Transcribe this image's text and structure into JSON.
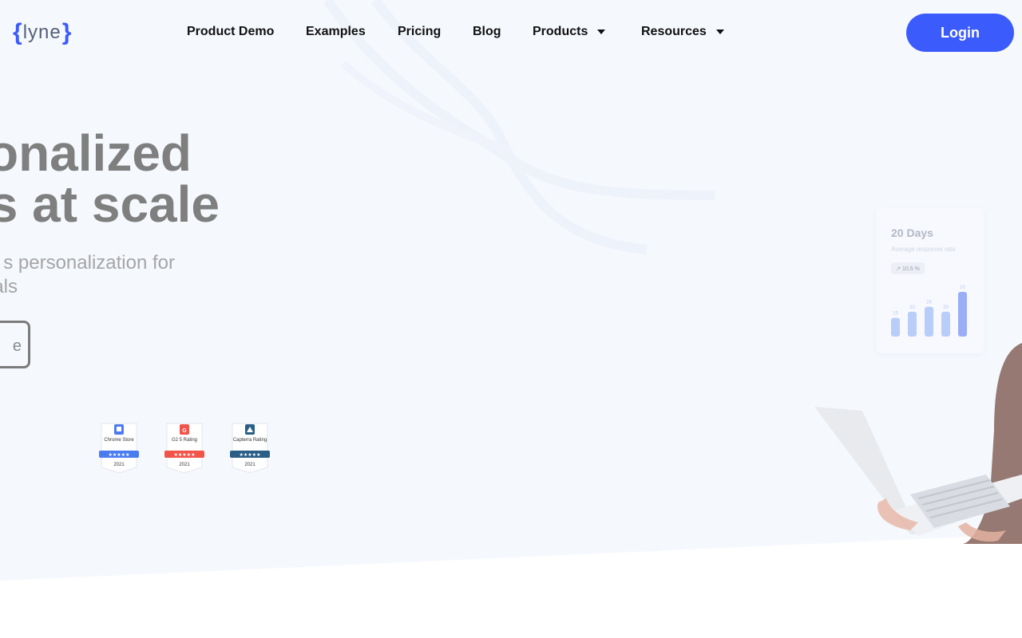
{
  "brand": {
    "logo_open": "{",
    "logo_word": "lyne",
    "logo_close": "}",
    "accent": "#3b5bfc"
  },
  "nav": {
    "items": [
      {
        "label": "Product Demo",
        "dropdown": false
      },
      {
        "label": "Examples",
        "dropdown": false
      },
      {
        "label": "Pricing",
        "dropdown": false
      },
      {
        "label": "Blog",
        "dropdown": false
      },
      {
        "label": "Products",
        "dropdown": true
      },
      {
        "label": "Resources",
        "dropdown": true
      }
    ],
    "login_label": "Login"
  },
  "hero": {
    "headline_line1": "onalized",
    "headline_line2": "s at scale",
    "sub_line1": "s  personalization  for",
    "sub_line2": "als",
    "cta_label": "e"
  },
  "badges": [
    {
      "title": "Chrome Store",
      "stars": "★★★★★",
      "year": "2021",
      "color": "#4a7cf0"
    },
    {
      "title": "G2 5 Rating",
      "stars": "★★★★★",
      "year": "2021",
      "color": "#f2544a"
    },
    {
      "title": "Capterra Rating",
      "stars": "★★★★★",
      "year": "2021",
      "color": "#2a5e87"
    }
  ],
  "stats_card": {
    "title": "20 Days",
    "subtitle": "Average response rate",
    "change": "↗ 10,5 %",
    "bars": [
      {
        "label": "15",
        "value": 15
      },
      {
        "label": "20",
        "value": 20
      },
      {
        "label": "24",
        "value": 24
      },
      {
        "label": "20",
        "value": 20
      },
      {
        "label": "10",
        "value": 36
      }
    ]
  }
}
